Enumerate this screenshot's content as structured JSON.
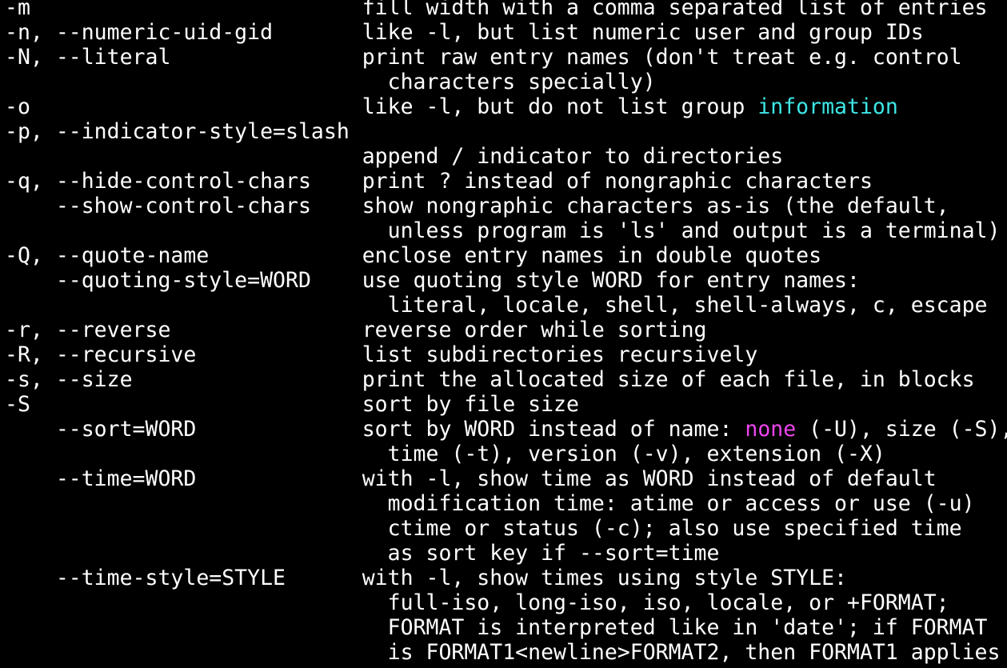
{
  "terminal": {
    "colors": {
      "background": "#000000",
      "foreground": "#ffffff",
      "cyan": "#3ee6e6",
      "magenta": "#ee44ee"
    },
    "lines": [
      [
        {
          "t": "-m                          fill width with a comma separated list of entries"
        }
      ],
      [
        {
          "t": "-n, --numeric-uid-gid       like -l, but list numeric user and group IDs"
        }
      ],
      [
        {
          "t": "-N, --literal               print raw entry names (don't treat e.g. control"
        }
      ],
      [
        {
          "t": "                              characters specially)"
        }
      ],
      [
        {
          "t": "-o                          like -l, but do not list group "
        },
        {
          "t": "information",
          "c": "cyan"
        }
      ],
      [
        {
          "t": "-p, --indicator-style=slash"
        }
      ],
      [
        {
          "t": "                            append / indicator to directories"
        }
      ],
      [
        {
          "t": "-q, --hide-control-chars    print ? instead of nongraphic characters"
        }
      ],
      [
        {
          "t": "    --show-control-chars    show nongraphic characters as-is (the default,"
        }
      ],
      [
        {
          "t": "                              unless program is 'ls' and output is a terminal)"
        }
      ],
      [
        {
          "t": "-Q, --quote-name            enclose entry names in double quotes"
        }
      ],
      [
        {
          "t": "    --quoting-style=WORD    use quoting style WORD for entry names:"
        }
      ],
      [
        {
          "t": "                              literal, locale, shell, shell-always, c, escape"
        }
      ],
      [
        {
          "t": "-r, --reverse               reverse order while sorting"
        }
      ],
      [
        {
          "t": "-R, --recursive             list subdirectories recursively"
        }
      ],
      [
        {
          "t": "-s, --size                  print the allocated size of each file, in blocks"
        }
      ],
      [
        {
          "t": "-S                          sort by file size"
        }
      ],
      [
        {
          "t": "    --sort=WORD             sort by WORD instead of name: "
        },
        {
          "t": "none",
          "c": "magenta"
        },
        {
          "t": " (-U), size (-S),"
        }
      ],
      [
        {
          "t": "                              time (-t), version (-v), extension (-X)"
        }
      ],
      [
        {
          "t": "    --time=WORD             with -l, show time as WORD instead of default"
        }
      ],
      [
        {
          "t": "                              modification time: atime or access or use (-u)"
        }
      ],
      [
        {
          "t": "                              ctime or status (-c); also use specified time"
        }
      ],
      [
        {
          "t": "                              as sort key if --sort=time"
        }
      ],
      [
        {
          "t": "    --time-style=STYLE      with -l, show times using style STYLE:"
        }
      ],
      [
        {
          "t": "                              full-iso, long-iso, iso, locale, or +FORMAT;"
        }
      ],
      [
        {
          "t": "                              FORMAT is interpreted like in 'date'; if FORMAT"
        }
      ],
      [
        {
          "t": "                              is FORMAT1<newline>FORMAT2, then FORMAT1 applies"
        }
      ]
    ]
  }
}
